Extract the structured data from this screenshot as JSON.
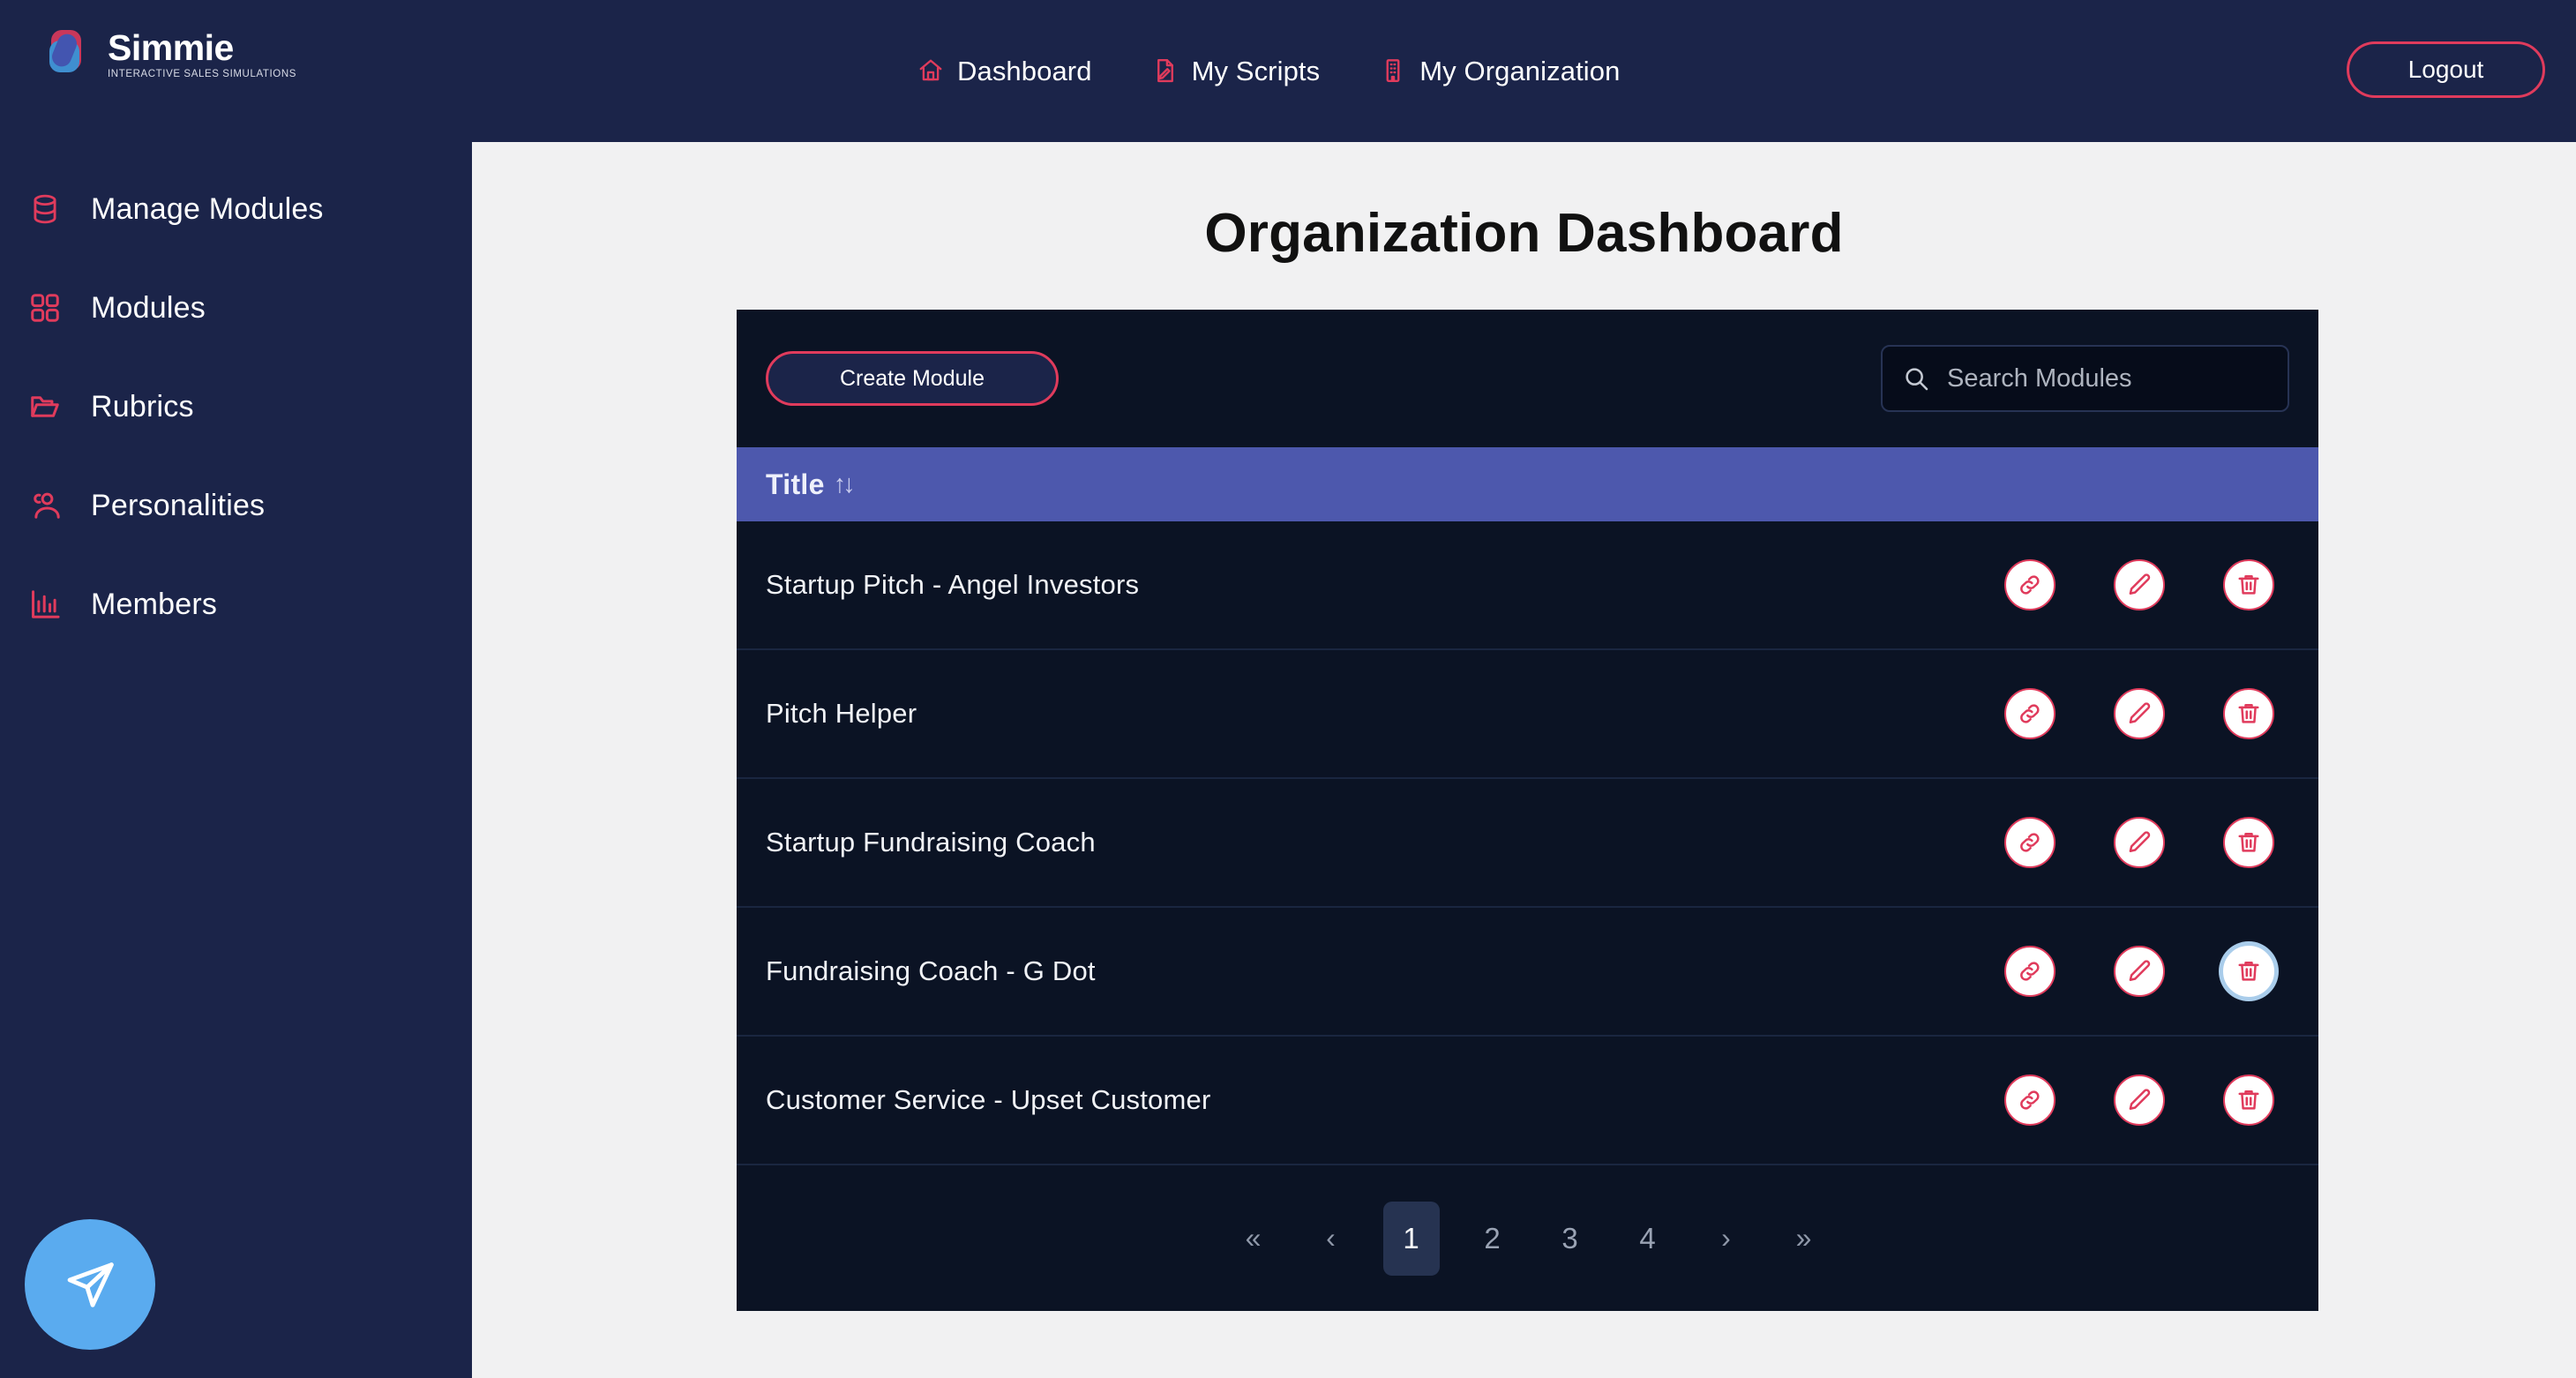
{
  "brand": {
    "name": "Simmie",
    "tagline": "INTERACTIVE SALES SIMULATIONS",
    "logo_icon": "simmie-logo-icon",
    "colors": {
      "red": "#c9375a",
      "blue": "#3f8fd0",
      "indigo": "#4355b0"
    }
  },
  "topnav": {
    "items": [
      {
        "label": "Dashboard",
        "icon": "home-icon"
      },
      {
        "label": "My Scripts",
        "icon": "document-pen-icon"
      },
      {
        "label": "My Organization",
        "icon": "building-icon"
      }
    ],
    "logout_label": "Logout"
  },
  "sidebar": {
    "items": [
      {
        "label": "Manage Modules",
        "icon": "database-icon"
      },
      {
        "label": "Modules",
        "icon": "grid-icon"
      },
      {
        "label": "Rubrics",
        "icon": "folder-open-icon"
      },
      {
        "label": "Personalities",
        "icon": "users-icon"
      },
      {
        "label": "Members",
        "icon": "bar-chart-icon"
      }
    ]
  },
  "main": {
    "page_title": "Organization Dashboard",
    "toolbar": {
      "create_label": "Create Module",
      "search_placeholder": "Search Modules",
      "search_value": "",
      "search_icon": "search-icon"
    },
    "table": {
      "columns": [
        {
          "label": "Title",
          "sort_glyph": "↑↓",
          "sortable": true
        }
      ],
      "rows": [
        {
          "title": "Startup Pitch - Angel Investors"
        },
        {
          "title": "Pitch Helper"
        },
        {
          "title": "Startup Fundraising Coach"
        },
        {
          "title": "Fundraising Coach - G Dot"
        },
        {
          "title": "Customer Service - Upset Customer"
        }
      ],
      "row_actions": [
        {
          "name": "link",
          "icon": "link-icon"
        },
        {
          "name": "edit",
          "icon": "pencil-icon"
        },
        {
          "name": "delete",
          "icon": "trash-icon"
        }
      ],
      "focused_action": {
        "row_index": 3,
        "action": "delete"
      }
    },
    "pagination": {
      "first_label": "«",
      "prev_label": "‹",
      "pages": [
        "1",
        "2",
        "3",
        "4"
      ],
      "current_page": "1",
      "next_label": "›",
      "last_label": "»"
    }
  },
  "fab": {
    "icon": "send-icon",
    "color": "#5aabef"
  },
  "colors": {
    "navy": "#1b2449",
    "card_bg": "#0b1324",
    "table_header": "#4d58ad",
    "accent_red": "#e03b5c",
    "page_bg": "#f1f1f2"
  }
}
